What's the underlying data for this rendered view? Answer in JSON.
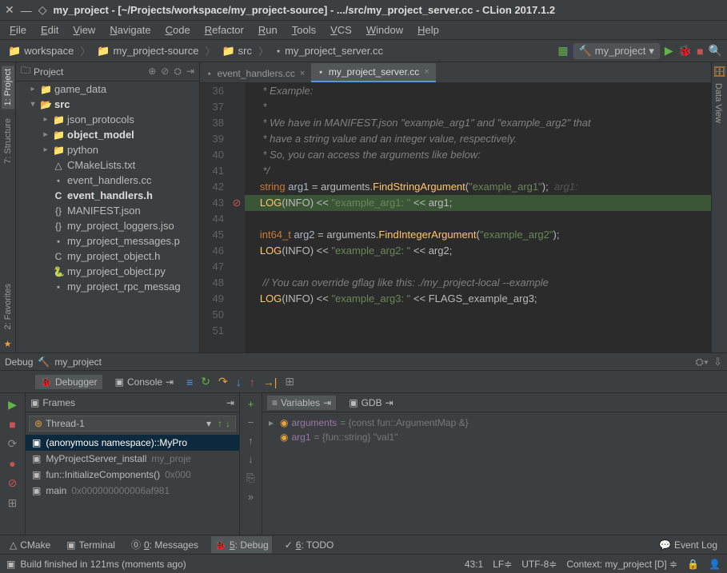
{
  "window": {
    "title": "my_project - [~/Projects/workspace/my_project-source] - .../src/my_project_server.cc - CLion 2017.1.2"
  },
  "menu": [
    "File",
    "Edit",
    "View",
    "Navigate",
    "Code",
    "Refactor",
    "Run",
    "Tools",
    "VCS",
    "Window",
    "Help"
  ],
  "breadcrumb": [
    "workspace",
    "my_project-source",
    "src",
    "my_project_server.cc"
  ],
  "run_config": "my_project",
  "project_panel": {
    "title": "Project"
  },
  "tree": [
    {
      "indent": 1,
      "arrow": "▸",
      "icon": "📁",
      "label": "game_data",
      "color": "#bbb"
    },
    {
      "indent": 1,
      "arrow": "▾",
      "icon": "📂",
      "label": "src",
      "color": "#ddd",
      "bold": true
    },
    {
      "indent": 2,
      "arrow": "▸",
      "icon": "📁",
      "label": "json_protocols",
      "color": "#bbb"
    },
    {
      "indent": 2,
      "arrow": "▸",
      "icon": "📁",
      "label": "object_model",
      "color": "#ddd",
      "bold": true
    },
    {
      "indent": 2,
      "arrow": "▸",
      "icon": "📁",
      "label": "python",
      "color": "#bbb"
    },
    {
      "indent": 2,
      "arrow": "",
      "icon": "△",
      "label": "CMakeLists.txt",
      "color": "#bbb"
    },
    {
      "indent": 2,
      "arrow": "",
      "icon": "⋆",
      "label": "event_handlers.cc",
      "color": "#bbb"
    },
    {
      "indent": 2,
      "arrow": "",
      "icon": "C",
      "label": "event_handlers.h",
      "color": "#ddd",
      "bold": true
    },
    {
      "indent": 2,
      "arrow": "",
      "icon": "{}",
      "label": "MANIFEST.json",
      "color": "#bbb"
    },
    {
      "indent": 2,
      "arrow": "",
      "icon": "{}",
      "label": "my_project_loggers.jso",
      "color": "#bbb"
    },
    {
      "indent": 2,
      "arrow": "",
      "icon": "⋆",
      "label": "my_project_messages.p",
      "color": "#bbb"
    },
    {
      "indent": 2,
      "arrow": "",
      "icon": "C",
      "label": "my_project_object.h",
      "color": "#bbb"
    },
    {
      "indent": 2,
      "arrow": "",
      "icon": "🐍",
      "label": "my_project_object.py",
      "color": "#bbb"
    },
    {
      "indent": 2,
      "arrow": "",
      "icon": "⋆",
      "label": "my_project_rpc_messag",
      "color": "#bbb"
    }
  ],
  "editor_tabs": [
    {
      "label": "event_handlers.cc",
      "active": false
    },
    {
      "label": "my_project_server.cc",
      "active": true
    }
  ],
  "code_lines": [
    {
      "n": 36,
      "html": "    <span class='c-comment'>* Example:</span>"
    },
    {
      "n": 37,
      "html": "    <span class='c-comment'>*</span>"
    },
    {
      "n": 38,
      "html": "    <span class='c-comment'>* We have in MANIFEST.json \"example_arg1\" and \"example_arg2\" that </span>"
    },
    {
      "n": 39,
      "html": "    <span class='c-comment'>* have a string value and an integer value, respectively.</span>"
    },
    {
      "n": 40,
      "html": "    <span class='c-comment'>* So, you can access the arguments like below:</span>"
    },
    {
      "n": 41,
      "html": "    <span class='c-comment'>*/</span>"
    },
    {
      "n": 42,
      "html": "   <span class='c-type'>string</span> <span class='c-ident'>arg1</span> = arguments.<span class='c-func'>FindStringArgument</span>(<span class='c-str'>\"example_arg1\"</span>);  <span class='c-ghost'>arg1:</span>"
    },
    {
      "n": 43,
      "exec": true,
      "mark": "⊘",
      "html": "   <span class='c-func'>LOG</span>(INFO) &lt;&lt; <span class='c-str'>\"example_arg1: \"</span> &lt;&lt; arg1;"
    },
    {
      "n": 44,
      "html": ""
    },
    {
      "n": 45,
      "html": "   <span class='c-type'>int64_t</span> <span class='c-ident'>arg2</span> = arguments.<span class='c-func'>FindIntegerArgument</span>(<span class='c-str'>\"example_arg2\"</span>);"
    },
    {
      "n": 46,
      "html": "   <span class='c-func'>LOG</span>(INFO) &lt;&lt; <span class='c-str'>\"example_arg2: \"</span> &lt;&lt; arg2;"
    },
    {
      "n": 47,
      "html": ""
    },
    {
      "n": 48,
      "html": "    <span class='c-comment'>// You can override gflag like this: ./my_project-local --example</span>"
    },
    {
      "n": 49,
      "html": "   <span class='c-func'>LOG</span>(INFO) &lt;&lt; <span class='c-str'>\"example_arg3: \"</span> &lt;&lt; FLAGS_example_arg3;"
    },
    {
      "n": 50,
      "html": ""
    },
    {
      "n": 51,
      "html": ""
    }
  ],
  "debug": {
    "title": "Debug",
    "config": "my_project",
    "debugger_tab": "Debugger",
    "console_tab": "Console",
    "frames_title": "Frames",
    "thread": "Thread-1",
    "frames": [
      {
        "label": "(anonymous namespace)::MyPro",
        "sel": true
      },
      {
        "label": "MyProjectServer_install",
        "extra": "my_proje"
      },
      {
        "label": "fun::InitializeComponents()",
        "extra": "0x000"
      },
      {
        "label": "main",
        "extra": "0x000000000006af981"
      }
    ],
    "vars_tab": "Variables",
    "gdb_tab": "GDB",
    "vars": [
      {
        "arrow": "▸",
        "name": "arguments",
        "val": "= {const fun::ArgumentMap &}"
      },
      {
        "arrow": "",
        "name": "arg1",
        "val": "= {fun::string} \"val1\""
      }
    ]
  },
  "bottom_tabs": [
    {
      "icon": "△",
      "label": "CMake"
    },
    {
      "icon": "▣",
      "label": "Terminal"
    },
    {
      "icon": "⓪",
      "label": "0: Messages"
    },
    {
      "icon": "🐞",
      "label": "5: Debug",
      "active": true
    },
    {
      "icon": "✓",
      "label": "6: TODO"
    }
  ],
  "event_log": "Event Log",
  "status": {
    "message": "Build finished in 121ms (moments ago)",
    "pos": "43:1",
    "lf": "LF≑",
    "enc": "UTF-8≑",
    "context": "Context: my_project [D] ≑"
  },
  "side_tabs": {
    "project": "1: Project",
    "structure": "7: Structure",
    "favorites": "2: Favorites",
    "dataview": "Data View"
  }
}
